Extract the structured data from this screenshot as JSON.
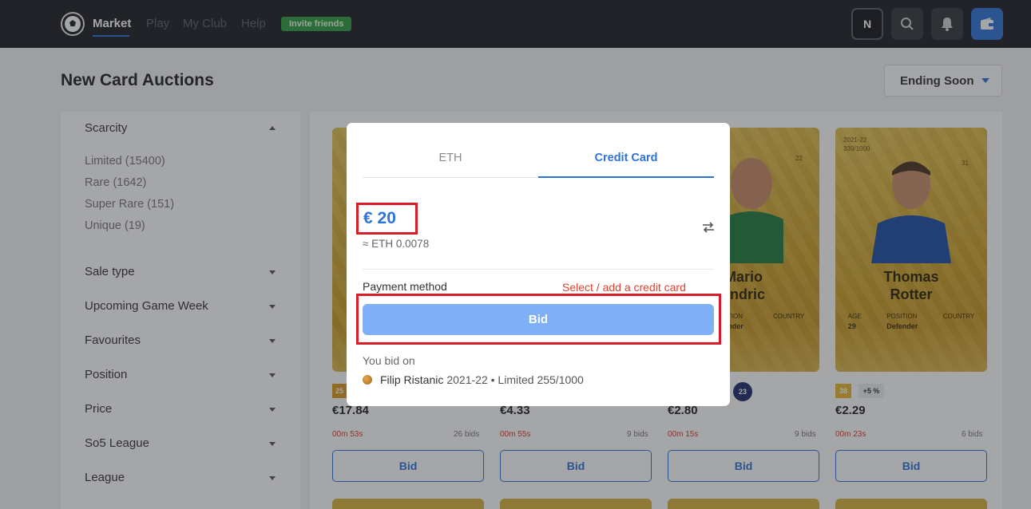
{
  "nav": {
    "items": [
      {
        "label": "Market",
        "active": true
      },
      {
        "label": "Play"
      },
      {
        "label": "My Club"
      },
      {
        "label": "Help"
      }
    ],
    "invite_label": "Invite friends",
    "account_initial": "N",
    "icons": [
      "soccer-ball-icon",
      "search-icon",
      "bell-icon",
      "wallet-icon"
    ]
  },
  "page": {
    "title": "New Card Auctions",
    "sort_label": "Ending Soon"
  },
  "filters": {
    "scarcity_label": "Scarcity",
    "scarcity_options": [
      "Limited (15400)",
      "Rare (1642)",
      "Super Rare (151)",
      "Unique (19)"
    ],
    "others": [
      "Sale type",
      "Upcoming Game Week",
      "Favourites",
      "Position",
      "Price",
      "So5 League",
      "League"
    ]
  },
  "cards": [
    {
      "level": "25",
      "price": "€17.84",
      "timer": "00m 53s",
      "bids": "26 bids",
      "bid_label": "Bid"
    },
    {
      "price": "€4.33",
      "timer": "00m 55s",
      "bids": "9 bids",
      "bid_label": "Bid"
    },
    {
      "name": "Mario\nandric",
      "position_label": "POSITION",
      "position": "Defender",
      "country_label": "COUNTRY",
      "jersey": "22",
      "level": "23",
      "price": "€2.80",
      "timer": "00m 15s",
      "bids": "9 bids",
      "bid_label": "Bid"
    },
    {
      "season": "2021-22",
      "serial": "339/1000",
      "jersey": "31",
      "name": "Thomas\nRotter",
      "age_label": "AGE",
      "age": "29",
      "position_label": "POSITION",
      "position": "Defender",
      "country_label": "COUNTRY",
      "level": "38",
      "bonus": "+5 %",
      "price": "€2.29",
      "timer": "00m 23s",
      "bids": "6 bids",
      "bid_label": "Bid"
    }
  ],
  "modal": {
    "tabs": [
      "ETH",
      "Credit Card"
    ],
    "active_tab": "Credit Card",
    "amount": "€ 20",
    "eth_approx": "≈ ETH 0.0078",
    "payment_method_label": "Payment method",
    "payment_link": "Select / add a credit card",
    "bid_label": "Bid",
    "you_bid_on_label": "You bid on",
    "card_player": "Filip Ristanic",
    "card_meta": "2021-22 • Limited 255/1000"
  },
  "colors": {
    "accent": "#2d73d8",
    "highlight": "#d81d2a",
    "warning_text": "#e0412f",
    "nav_bg": "#1d1e24"
  }
}
